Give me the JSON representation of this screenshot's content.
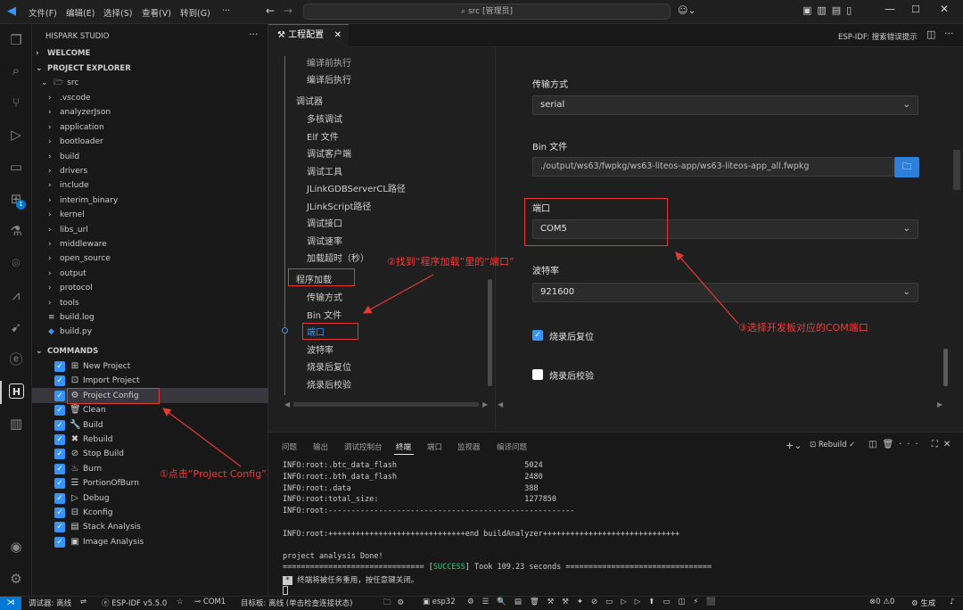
{
  "titlebar": {
    "menus": [
      "文件(F)",
      "编辑(E)",
      "选择(S)",
      "查看(V)",
      "转到(G)",
      "···"
    ],
    "search": "src [管理员]"
  },
  "sidebar": {
    "title": "HISPARK STUDIO",
    "welcome": "WELCOME",
    "explorer": "PROJECT EXPLORER",
    "root": "src",
    "folders": [
      ".vscode",
      "analyzerJson",
      "application",
      "bootloader",
      "build",
      "drivers",
      "include",
      "interim_binary",
      "kernel",
      "libs_url",
      "middleware",
      "open_source",
      "output",
      "protocol",
      "tools"
    ],
    "files": [
      "build.log",
      "build.py"
    ],
    "commands_header": "COMMANDS",
    "commands": [
      {
        "label": "New Project",
        "icon": "new-project-icon",
        "glyph": "⊞"
      },
      {
        "label": "Import Project",
        "icon": "import-icon",
        "glyph": "⊡"
      },
      {
        "label": "Project Config",
        "icon": "gear-icon",
        "glyph": "⚙"
      },
      {
        "label": "Clean",
        "icon": "trash-icon",
        "glyph": "🗑"
      },
      {
        "label": "Build",
        "icon": "wrench-icon",
        "glyph": "🔧"
      },
      {
        "label": "Rebuild",
        "icon": "tools-icon",
        "glyph": "✖"
      },
      {
        "label": "Stop Build",
        "icon": "stop-icon",
        "glyph": "⊘"
      },
      {
        "label": "Burn",
        "icon": "flame-icon",
        "glyph": "♨"
      },
      {
        "label": "PortionOfBurn",
        "icon": "list-icon",
        "glyph": "☰"
      },
      {
        "label": "Debug",
        "icon": "debug-icon",
        "glyph": "▷"
      },
      {
        "label": "Kconfig",
        "icon": "kconfig-icon",
        "glyph": "⊟"
      },
      {
        "label": "Stack Analysis",
        "icon": "chart-icon",
        "glyph": "▤"
      },
      {
        "label": "Image Analysis",
        "icon": "image-icon",
        "glyph": "▣"
      }
    ]
  },
  "editor": {
    "tab_label": "工程配置",
    "right_label": "ESP-IDF: 搜索错误提示",
    "nav": {
      "partial": "编译前执行",
      "post_build": "编译后执行",
      "debugger": "调试器",
      "debugger_items": [
        "多核调试",
        "Elf 文件",
        "调试客户端",
        "调试工具",
        "JLinkGDBServerCL路径",
        "JLinkScript路径",
        "调试接口",
        "调试速率",
        "加载超时（秒）"
      ],
      "program_load": "程序加载",
      "program_items": [
        "传输方式",
        "Bin 文件",
        "端口",
        "波特率",
        "烧录后复位",
        "烧录后校验"
      ]
    },
    "form": {
      "transfer_label": "传输方式",
      "transfer_value": "serial",
      "bin_label": "Bin 文件",
      "bin_value": "./output/ws63/fwpkg/ws63-liteos-app/ws63-liteos-app_all.fwpkg",
      "port_label": "端口",
      "port_value": "COM5",
      "baud_label": "波特率",
      "baud_value": "921600",
      "reset_label": "烧录后复位",
      "reset_checked": true,
      "verify_label": "烧录后校验",
      "verify_checked": false
    }
  },
  "panel": {
    "tabs": [
      "问题",
      "输出",
      "调试控制台",
      "终端",
      "端口",
      "监视器",
      "编译问题"
    ],
    "active_tab": "终端",
    "rebuild_label": "Rebuild",
    "lines": [
      "INFO:root:.btc_data_flash                            5024",
      "INFO:root:.bth_data_flash                            2480",
      "INFO:root:.data                                      388",
      "INFO:root:total_size:                                1277850",
      "INFO:root:------------------------------------------------------",
      "",
      "INFO:root:++++++++++++++++++++++++++++++end buildAnalyzer++++++++++++++++++++++++++++++",
      "",
      "project analysis Done!"
    ],
    "success_prefix": "=============================== [",
    "success_word": "SUCCESS",
    "success_suffix": "] Took 109.23 seconds ================================",
    "reuse_msg": "终端将被任务重用，按任意键关闭。"
  },
  "statusbar": {
    "debugger": "调试器: 离线",
    "idf": "ESP-IDF v5.5.0",
    "port": "COM1",
    "target": "目标板: 离线 (单击检查连接状态)",
    "chip": "esp32",
    "problems": "0",
    "warnings": "0",
    "generate": "生成"
  },
  "annotations": {
    "step1": "①点击“ProJect Config”",
    "step2": "②找到“程序加载”里的“端口”",
    "step3": "③选择开发板对应的COM端口"
  },
  "colors": {
    "accent": "#0078d4",
    "checkbox": "#3794ff",
    "annotation": "#e53935",
    "success": "#23d18b"
  }
}
